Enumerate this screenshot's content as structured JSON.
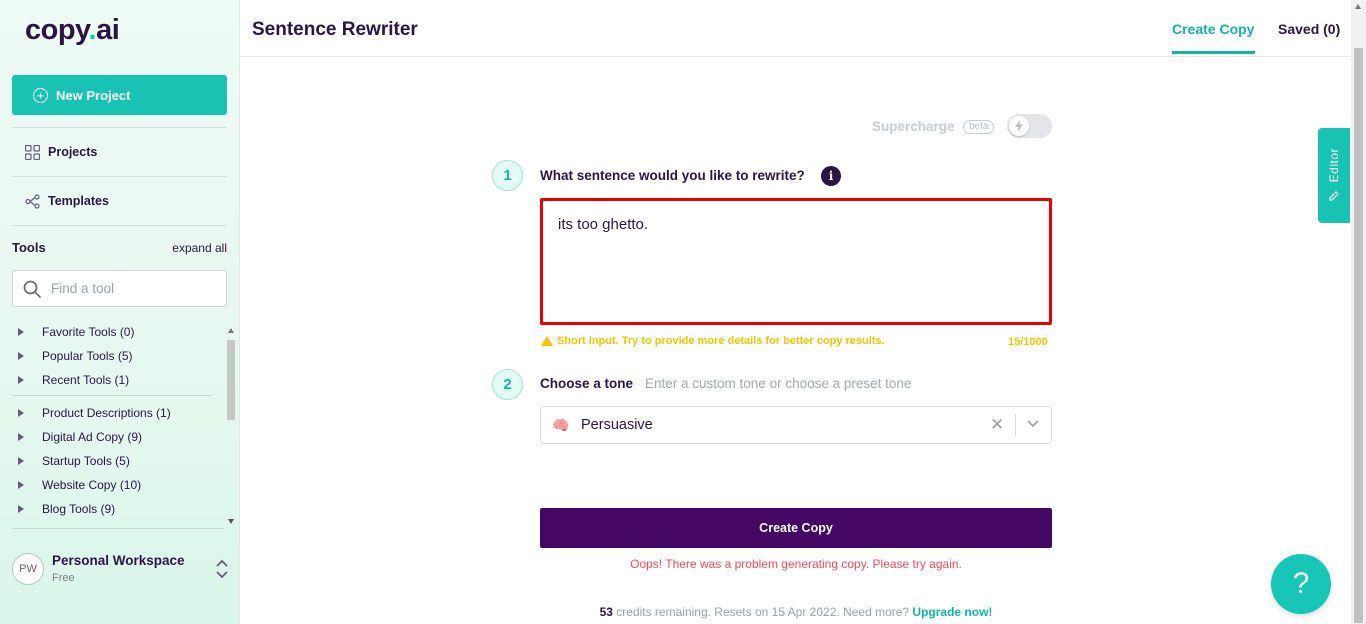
{
  "app": {
    "logo_main": "copy",
    "logo_dot": ".",
    "logo_suffix": "ai"
  },
  "sidebar": {
    "new_project_label": "New Project",
    "projects_label": "Projects",
    "templates_label": "Templates",
    "tools_heading": "Tools",
    "expand_all": "expand all",
    "find_placeholder": "Find a tool",
    "tool_groups": [
      {
        "label": "Favorite Tools (0)"
      },
      {
        "label": "Popular Tools (5)"
      },
      {
        "label": "Recent Tools (1)"
      },
      {
        "label": "Product Descriptions (1)"
      },
      {
        "label": "Digital Ad Copy (9)"
      },
      {
        "label": "Startup Tools (5)"
      },
      {
        "label": "Website Copy (10)"
      },
      {
        "label": "Blog Tools (9)"
      }
    ],
    "workspace": {
      "initials": "PW",
      "name": "Personal Workspace",
      "plan": "Free"
    }
  },
  "header": {
    "title": "Sentence Rewriter",
    "tab_create": "Create Copy",
    "tab_saved": "Saved (0)"
  },
  "editor_tab": "Editor",
  "form": {
    "supercharge_label": "Supercharge",
    "beta_badge": "beta",
    "supercharge_on": false,
    "step1_number": "1",
    "step1_question": "What sentence would you like to rewrite?",
    "info_glyph": "i",
    "step1_value": "its too ghetto.",
    "warning_text": "Short input. Try to provide more details for better copy results.",
    "char_count": "15/1000",
    "step2_number": "2",
    "step2_label": "Choose a tone",
    "step2_hint": "Enter a custom tone or choose a preset tone",
    "tone_emoji": "🧠",
    "tone_value": "Persuasive",
    "clear_glyph": "✕",
    "create_button": "Create Copy",
    "error_text": "Oops! There was a problem generating copy. Please try again.",
    "credits_count": "53",
    "credits_text": " credits remaining. Resets on 15 Apr 2022. Need more? ",
    "upgrade_link": "Upgrade now!"
  },
  "help_glyph": "?",
  "colors": {
    "accent": "#19c3b3",
    "primary_button": "#450764",
    "error": "#f04a5a",
    "warning": "#f2c300",
    "input_error_border": "#e60000"
  }
}
